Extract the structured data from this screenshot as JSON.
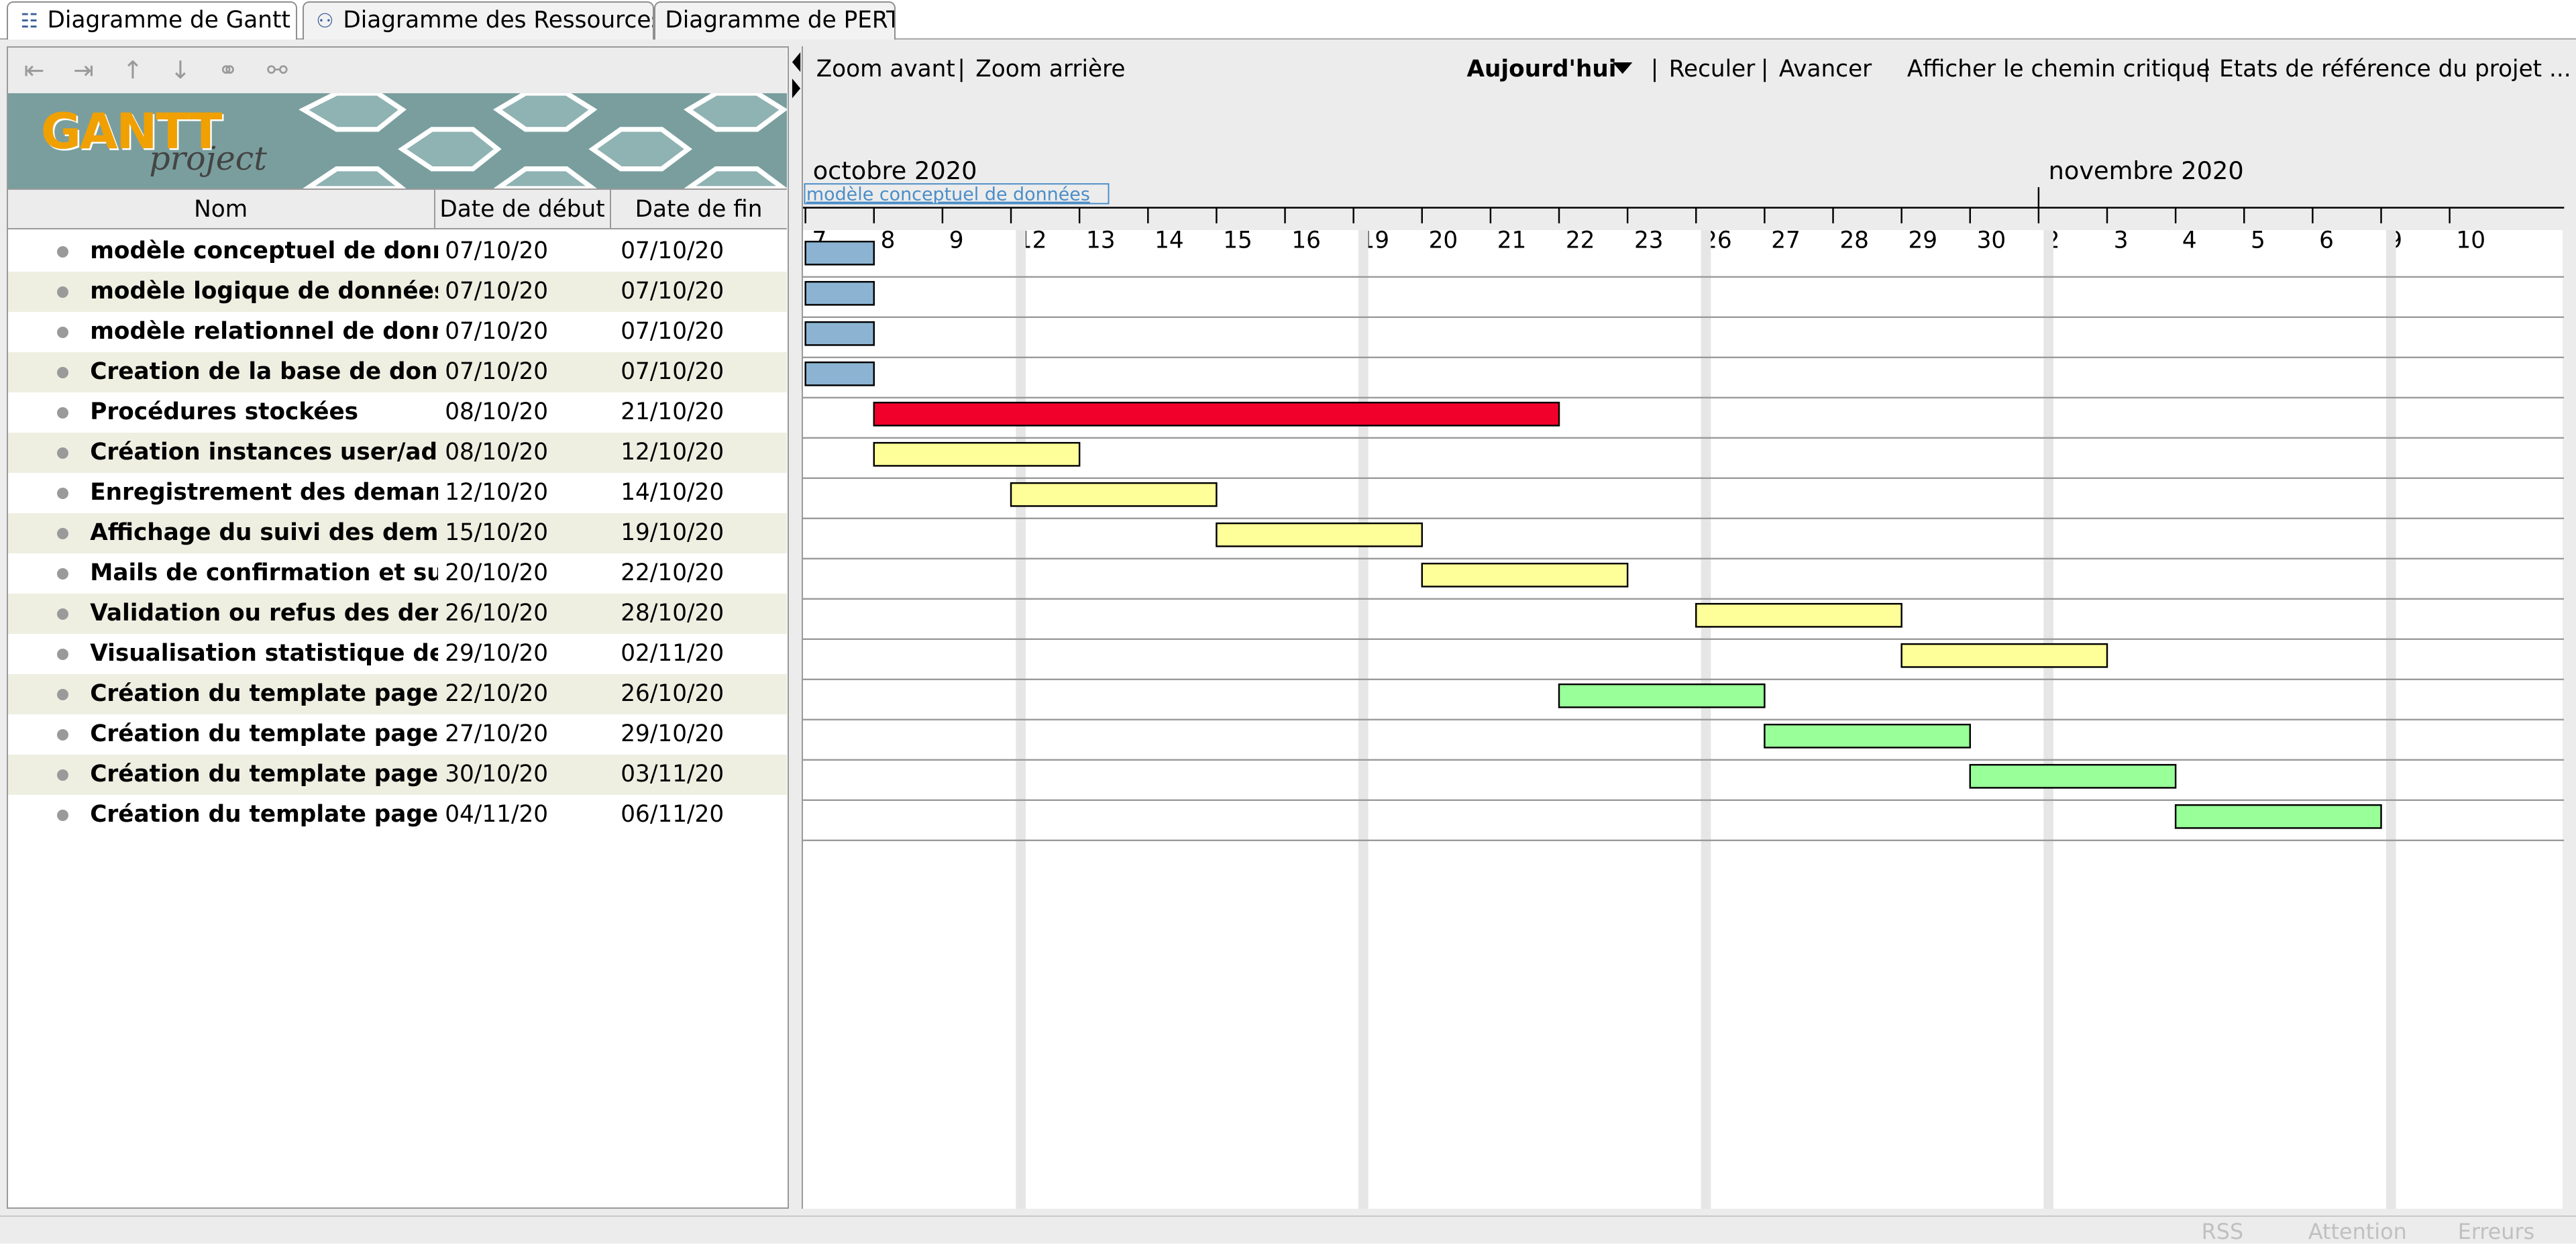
{
  "tabs": [
    {
      "label": "Diagramme de Gantt",
      "icon": "gantt-icon",
      "active": true
    },
    {
      "label": "Diagramme des Ressources",
      "icon": "resources-icon",
      "active": false
    },
    {
      "label": "Diagramme de PERT",
      "icon": "",
      "active": false
    }
  ],
  "left_toolbar": {
    "icons": [
      "outdent-icon",
      "indent-icon",
      "move-up-icon",
      "move-down-icon",
      "link-icon",
      "unlink-icon"
    ]
  },
  "logo": {
    "main": "GANTT",
    "sub": "project"
  },
  "table": {
    "columns": [
      "Nom",
      "Date de début",
      "Date de fin"
    ],
    "rows": [
      {
        "name": "modèle conceptuel de données",
        "start": "07/10/20",
        "end": "07/10/20"
      },
      {
        "name": "modèle logique de données",
        "start": "07/10/20",
        "end": "07/10/20"
      },
      {
        "name": "modèle relationnel de données",
        "start": "07/10/20",
        "end": "07/10/20"
      },
      {
        "name": "Creation de la base de données",
        "start": "07/10/20",
        "end": "07/10/20"
      },
      {
        "name": "Procédures stockées",
        "start": "08/10/20",
        "end": "21/10/20"
      },
      {
        "name": "Création instances user/admin",
        "start": "08/10/20",
        "end": "12/10/20"
      },
      {
        "name": "Enregistrement des demandes ...",
        "start": "12/10/20",
        "end": "14/10/20"
      },
      {
        "name": "Affichage du suivi des demand...",
        "start": "15/10/20",
        "end": "19/10/20"
      },
      {
        "name": "Mails de confirmation et suivi ...",
        "start": "20/10/20",
        "end": "22/10/20"
      },
      {
        "name": "Validation ou refus des deman...",
        "start": "26/10/20",
        "end": "28/10/20"
      },
      {
        "name": "Visualisation statistique des de...",
        "start": "29/10/20",
        "end": "02/11/20"
      },
      {
        "name": "Création du template page d'i...",
        "start": "22/10/20",
        "end": "26/10/20"
      },
      {
        "name": "Création du template page de ...",
        "start": "27/10/20",
        "end": "29/10/20"
      },
      {
        "name": "Création du template page util...",
        "start": "30/10/20",
        "end": "03/11/20"
      },
      {
        "name": "Création du template page ad...",
        "start": "04/11/20",
        "end": "06/11/20"
      }
    ]
  },
  "gantt_toolbar": {
    "zoom_in": "Zoom avant",
    "zoom_out": "Zoom arrière",
    "today": "Aujourd'hui",
    "back": "Reculer",
    "forward": "Avancer",
    "critical_path": "Afficher le chemin critique",
    "baselines": "Etats de référence du projet ...",
    "separator": "|"
  },
  "timeline": {
    "months": [
      {
        "label": "octobre 2020"
      },
      {
        "label": "novembre 2020"
      }
    ],
    "hover_label": "modèle conceptuel de données",
    "days": [
      {
        "label": "7",
        "date": "2020-10-07"
      },
      {
        "label": "8",
        "date": "2020-10-08"
      },
      {
        "label": "9",
        "date": "2020-10-09"
      },
      {
        "label": "12",
        "date": "2020-10-12"
      },
      {
        "label": "13",
        "date": "2020-10-13"
      },
      {
        "label": "14",
        "date": "2020-10-14"
      },
      {
        "label": "15",
        "date": "2020-10-15"
      },
      {
        "label": "16",
        "date": "2020-10-16"
      },
      {
        "label": "19",
        "date": "2020-10-19"
      },
      {
        "label": "20",
        "date": "2020-10-20"
      },
      {
        "label": "21",
        "date": "2020-10-21"
      },
      {
        "label": "22",
        "date": "2020-10-22"
      },
      {
        "label": "23",
        "date": "2020-10-23"
      },
      {
        "label": "26",
        "date": "2020-10-26"
      },
      {
        "label": "27",
        "date": "2020-10-27"
      },
      {
        "label": "28",
        "date": "2020-10-28"
      },
      {
        "label": "29",
        "date": "2020-10-29"
      },
      {
        "label": "30",
        "date": "2020-10-30"
      },
      {
        "label": "2",
        "date": "2020-11-02"
      },
      {
        "label": "3",
        "date": "2020-11-03"
      },
      {
        "label": "4",
        "date": "2020-11-04"
      },
      {
        "label": "5",
        "date": "2020-11-05"
      },
      {
        "label": "6",
        "date": "2020-11-06"
      },
      {
        "label": "9",
        "date": "2020-11-09"
      },
      {
        "label": "10",
        "date": "2020-11-10"
      }
    ],
    "weekends_after": [
      "2020-10-09",
      "2020-10-16",
      "2020-10-23",
      "2020-10-30",
      "2020-11-06"
    ]
  },
  "bars": [
    {
      "start": "2020-10-07",
      "end": "2020-10-07",
      "color": "#8cb4d2"
    },
    {
      "start": "2020-10-07",
      "end": "2020-10-07",
      "color": "#8cb4d2"
    },
    {
      "start": "2020-10-07",
      "end": "2020-10-07",
      "color": "#8cb4d2"
    },
    {
      "start": "2020-10-07",
      "end": "2020-10-07",
      "color": "#8cb4d2"
    },
    {
      "start": "2020-10-08",
      "end": "2020-10-21",
      "color": "#f0002a"
    },
    {
      "start": "2020-10-08",
      "end": "2020-10-12",
      "color": "#ffff99"
    },
    {
      "start": "2020-10-12",
      "end": "2020-10-14",
      "color": "#ffff99"
    },
    {
      "start": "2020-10-15",
      "end": "2020-10-19",
      "color": "#ffff99"
    },
    {
      "start": "2020-10-20",
      "end": "2020-10-22",
      "color": "#ffff99"
    },
    {
      "start": "2020-10-26",
      "end": "2020-10-28",
      "color": "#ffff99"
    },
    {
      "start": "2020-10-29",
      "end": "2020-11-02",
      "color": "#ffff99"
    },
    {
      "start": "2020-10-22",
      "end": "2020-10-26",
      "color": "#99ff99"
    },
    {
      "start": "2020-10-27",
      "end": "2020-10-29",
      "color": "#99ff99"
    },
    {
      "start": "2020-10-30",
      "end": "2020-11-03",
      "color": "#99ff99"
    },
    {
      "start": "2020-11-04",
      "end": "2020-11-06",
      "color": "#99ff99"
    }
  ],
  "status": [
    "RSS",
    "Attention",
    "Erreurs"
  ]
}
